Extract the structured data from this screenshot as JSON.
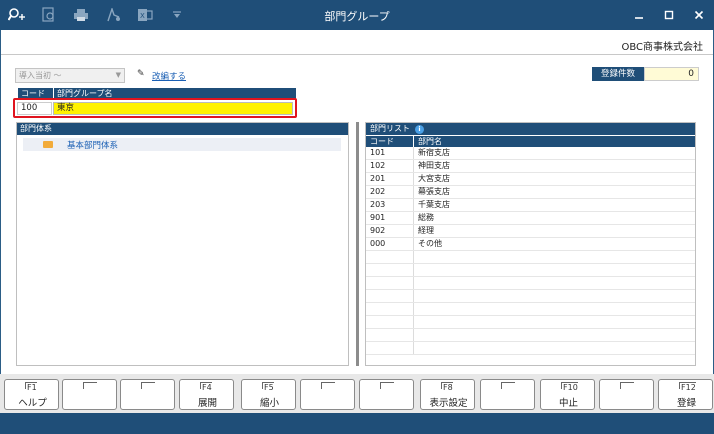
{
  "window": {
    "title": "部門グループ"
  },
  "toolbar_icons": [
    "search-plus-icon",
    "preview-icon",
    "print-icon",
    "pdf-export-icon",
    "excel-export-icon",
    "dropdown-icon"
  ],
  "header": {
    "company": "OBC商事株式会社"
  },
  "period": {
    "value": "導入当初 ～"
  },
  "revise": {
    "label": "改編する"
  },
  "count": {
    "label": "登録件数",
    "value": "0"
  },
  "group": {
    "code_header": "コード",
    "name_header": "部門グループ名",
    "code": "100",
    "name": "東京"
  },
  "tree": {
    "title": "部門体系",
    "items": [
      {
        "label": "基本部門体系"
      }
    ]
  },
  "list": {
    "title": "部門リスト",
    "columns": [
      "コード",
      "部門名"
    ],
    "rows": [
      [
        "101",
        "新宿支店"
      ],
      [
        "102",
        "神田支店"
      ],
      [
        "201",
        "大宮支店"
      ],
      [
        "202",
        "幕張支店"
      ],
      [
        "203",
        "千葉支店"
      ],
      [
        "901",
        "総務"
      ],
      [
        "902",
        "経理"
      ],
      [
        "000",
        "その他"
      ]
    ]
  },
  "fkeys": [
    {
      "code": "F1",
      "label": "ヘルプ"
    },
    {
      "code": "",
      "label": ""
    },
    {
      "code": "",
      "label": ""
    },
    {
      "code": "F4",
      "label": "展開"
    },
    {
      "code": "F5",
      "label": "縮小"
    },
    {
      "code": "",
      "label": ""
    },
    {
      "code": "",
      "label": ""
    },
    {
      "code": "F8",
      "label": "表示設定"
    },
    {
      "code": "",
      "label": ""
    },
    {
      "code": "F10",
      "label": "中止"
    },
    {
      "code": "",
      "label": ""
    },
    {
      "code": "F12",
      "label": "登録"
    }
  ],
  "colors": {
    "accent": "#1f4e78",
    "highlight": "#fff200",
    "focus_border": "#e0141e"
  }
}
